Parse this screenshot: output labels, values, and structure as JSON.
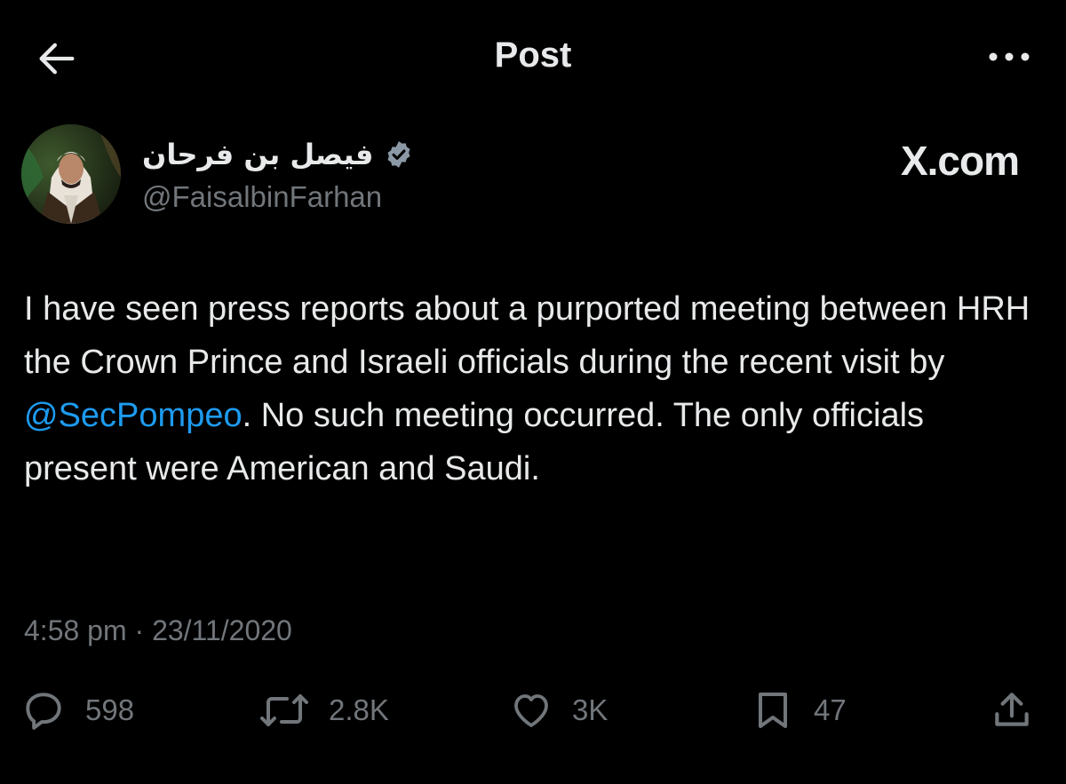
{
  "header": {
    "title": "Post",
    "back_icon": "arrow-left-icon",
    "more_icon": "more-horizontal-icon"
  },
  "author": {
    "display_name": "فيصل بن فرحان",
    "handle": "@FaisalbinFarhan",
    "verified_color": "#8b98a5"
  },
  "watermark": "X.com",
  "tweet": {
    "text_before": "I have seen press reports about a purported meeting between HRH the Crown Prince and Israeli officials during the recent visit by ",
    "mention": "@SecPompeo",
    "text_after": ". No such meeting occurred. The only officials present were American and Saudi."
  },
  "timestamp": "4:58 pm · 23/11/2020",
  "actions": {
    "replies": "598",
    "reposts": "2.8K",
    "likes": "3K",
    "bookmarks": "47"
  },
  "colors": {
    "background": "#000000",
    "text": "#e7e9ea",
    "muted": "#71767b",
    "accent": "#1d9bf0"
  }
}
